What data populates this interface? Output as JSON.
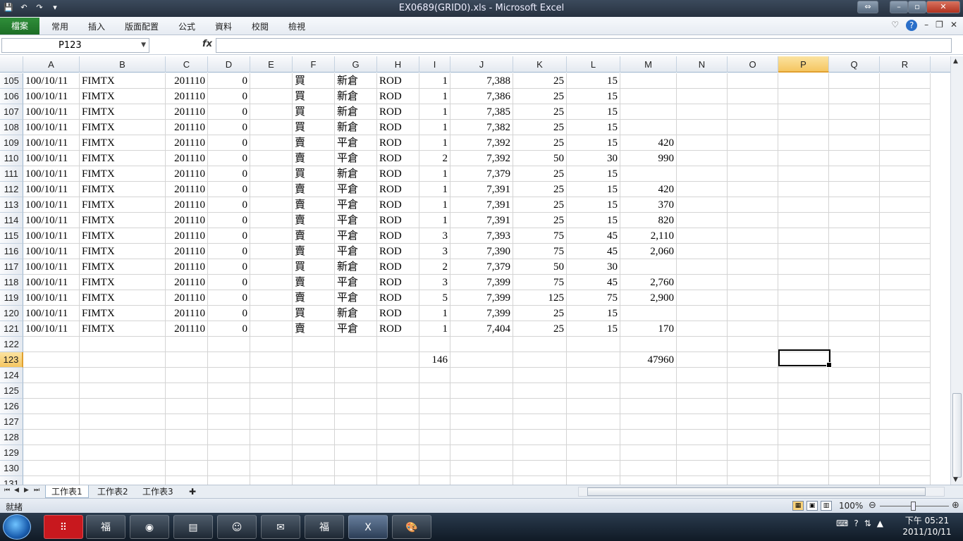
{
  "window": {
    "title": "EX0689(GRID0).xls  -  Microsoft Excel"
  },
  "qat": {
    "save": "💾",
    "undo": "↶",
    "redo": "↷",
    "customize": "▾"
  },
  "ribbon": {
    "file_tab": "檔案",
    "tabs": [
      "常用",
      "插入",
      "版面配置",
      "公式",
      "資料",
      "校閱",
      "檢視"
    ]
  },
  "formula_bar": {
    "name_box": "P123",
    "fx_label": "fx",
    "formula": ""
  },
  "columns": [
    "A",
    "B",
    "C",
    "D",
    "E",
    "F",
    "G",
    "H",
    "I",
    "J",
    "K",
    "L",
    "M",
    "N",
    "O",
    "P",
    "Q",
    "R"
  ],
  "active_column": "P",
  "active_row": "123",
  "rows": [
    {
      "num": "105",
      "A": "100/10/11",
      "B": "FIMTX",
      "C": "201110",
      "D": "0",
      "F": "買",
      "G": "新倉",
      "H": "ROD",
      "I": "1",
      "J": "7,388",
      "K": "25",
      "L": "15",
      "M": ""
    },
    {
      "num": "106",
      "A": "100/10/11",
      "B": "FIMTX",
      "C": "201110",
      "D": "0",
      "F": "買",
      "G": "新倉",
      "H": "ROD",
      "I": "1",
      "J": "7,386",
      "K": "25",
      "L": "15",
      "M": ""
    },
    {
      "num": "107",
      "A": "100/10/11",
      "B": "FIMTX",
      "C": "201110",
      "D": "0",
      "F": "買",
      "G": "新倉",
      "H": "ROD",
      "I": "1",
      "J": "7,385",
      "K": "25",
      "L": "15",
      "M": ""
    },
    {
      "num": "108",
      "A": "100/10/11",
      "B": "FIMTX",
      "C": "201110",
      "D": "0",
      "F": "買",
      "G": "新倉",
      "H": "ROD",
      "I": "1",
      "J": "7,382",
      "K": "25",
      "L": "15",
      "M": ""
    },
    {
      "num": "109",
      "A": "100/10/11",
      "B": "FIMTX",
      "C": "201110",
      "D": "0",
      "F": "賣",
      "G": "平倉",
      "H": "ROD",
      "I": "1",
      "J": "7,392",
      "K": "25",
      "L": "15",
      "M": "420"
    },
    {
      "num": "110",
      "A": "100/10/11",
      "B": "FIMTX",
      "C": "201110",
      "D": "0",
      "F": "賣",
      "G": "平倉",
      "H": "ROD",
      "I": "2",
      "J": "7,392",
      "K": "50",
      "L": "30",
      "M": "990"
    },
    {
      "num": "111",
      "A": "100/10/11",
      "B": "FIMTX",
      "C": "201110",
      "D": "0",
      "F": "買",
      "G": "新倉",
      "H": "ROD",
      "I": "1",
      "J": "7,379",
      "K": "25",
      "L": "15",
      "M": ""
    },
    {
      "num": "112",
      "A": "100/10/11",
      "B": "FIMTX",
      "C": "201110",
      "D": "0",
      "F": "賣",
      "G": "平倉",
      "H": "ROD",
      "I": "1",
      "J": "7,391",
      "K": "25",
      "L": "15",
      "M": "420"
    },
    {
      "num": "113",
      "A": "100/10/11",
      "B": "FIMTX",
      "C": "201110",
      "D": "0",
      "F": "賣",
      "G": "平倉",
      "H": "ROD",
      "I": "1",
      "J": "7,391",
      "K": "25",
      "L": "15",
      "M": "370"
    },
    {
      "num": "114",
      "A": "100/10/11",
      "B": "FIMTX",
      "C": "201110",
      "D": "0",
      "F": "賣",
      "G": "平倉",
      "H": "ROD",
      "I": "1",
      "J": "7,391",
      "K": "25",
      "L": "15",
      "M": "820"
    },
    {
      "num": "115",
      "A": "100/10/11",
      "B": "FIMTX",
      "C": "201110",
      "D": "0",
      "F": "賣",
      "G": "平倉",
      "H": "ROD",
      "I": "3",
      "J": "7,393",
      "K": "75",
      "L": "45",
      "M": "2,110"
    },
    {
      "num": "116",
      "A": "100/10/11",
      "B": "FIMTX",
      "C": "201110",
      "D": "0",
      "F": "賣",
      "G": "平倉",
      "H": "ROD",
      "I": "3",
      "J": "7,390",
      "K": "75",
      "L": "45",
      "M": "2,060"
    },
    {
      "num": "117",
      "A": "100/10/11",
      "B": "FIMTX",
      "C": "201110",
      "D": "0",
      "F": "買",
      "G": "新倉",
      "H": "ROD",
      "I": "2",
      "J": "7,379",
      "K": "50",
      "L": "30",
      "M": ""
    },
    {
      "num": "118",
      "A": "100/10/11",
      "B": "FIMTX",
      "C": "201110",
      "D": "0",
      "F": "賣",
      "G": "平倉",
      "H": "ROD",
      "I": "3",
      "J": "7,399",
      "K": "75",
      "L": "45",
      "M": "2,760"
    },
    {
      "num": "119",
      "A": "100/10/11",
      "B": "FIMTX",
      "C": "201110",
      "D": "0",
      "F": "賣",
      "G": "平倉",
      "H": "ROD",
      "I": "5",
      "J": "7,399",
      "K": "125",
      "L": "75",
      "M": "2,900"
    },
    {
      "num": "120",
      "A": "100/10/11",
      "B": "FIMTX",
      "C": "201110",
      "D": "0",
      "F": "買",
      "G": "新倉",
      "H": "ROD",
      "I": "1",
      "J": "7,399",
      "K": "25",
      "L": "15",
      "M": ""
    },
    {
      "num": "121",
      "A": "100/10/11",
      "B": "FIMTX",
      "C": "201110",
      "D": "0",
      "F": "賣",
      "G": "平倉",
      "H": "ROD",
      "I": "1",
      "J": "7,404",
      "K": "25",
      "L": "15",
      "M": "170"
    },
    {
      "num": "122"
    },
    {
      "num": "123",
      "I": "146",
      "M": "47960"
    },
    {
      "num": "124"
    },
    {
      "num": "125"
    },
    {
      "num": "126"
    },
    {
      "num": "127"
    },
    {
      "num": "128"
    },
    {
      "num": "129"
    },
    {
      "num": "130"
    },
    {
      "num": "131"
    }
  ],
  "sheets": [
    "工作表1",
    "工作表2",
    "工作表3"
  ],
  "active_sheet": "工作表1",
  "status": {
    "ready": "就緒",
    "zoom": "100%"
  },
  "taskbar": {
    "clock_time": "下午 05:21",
    "clock_date": "2011/10/11"
  },
  "colors": {
    "file_tab": "#1d6e26",
    "active_header": "#f5c661",
    "grid_line": "#d4d4d4"
  }
}
